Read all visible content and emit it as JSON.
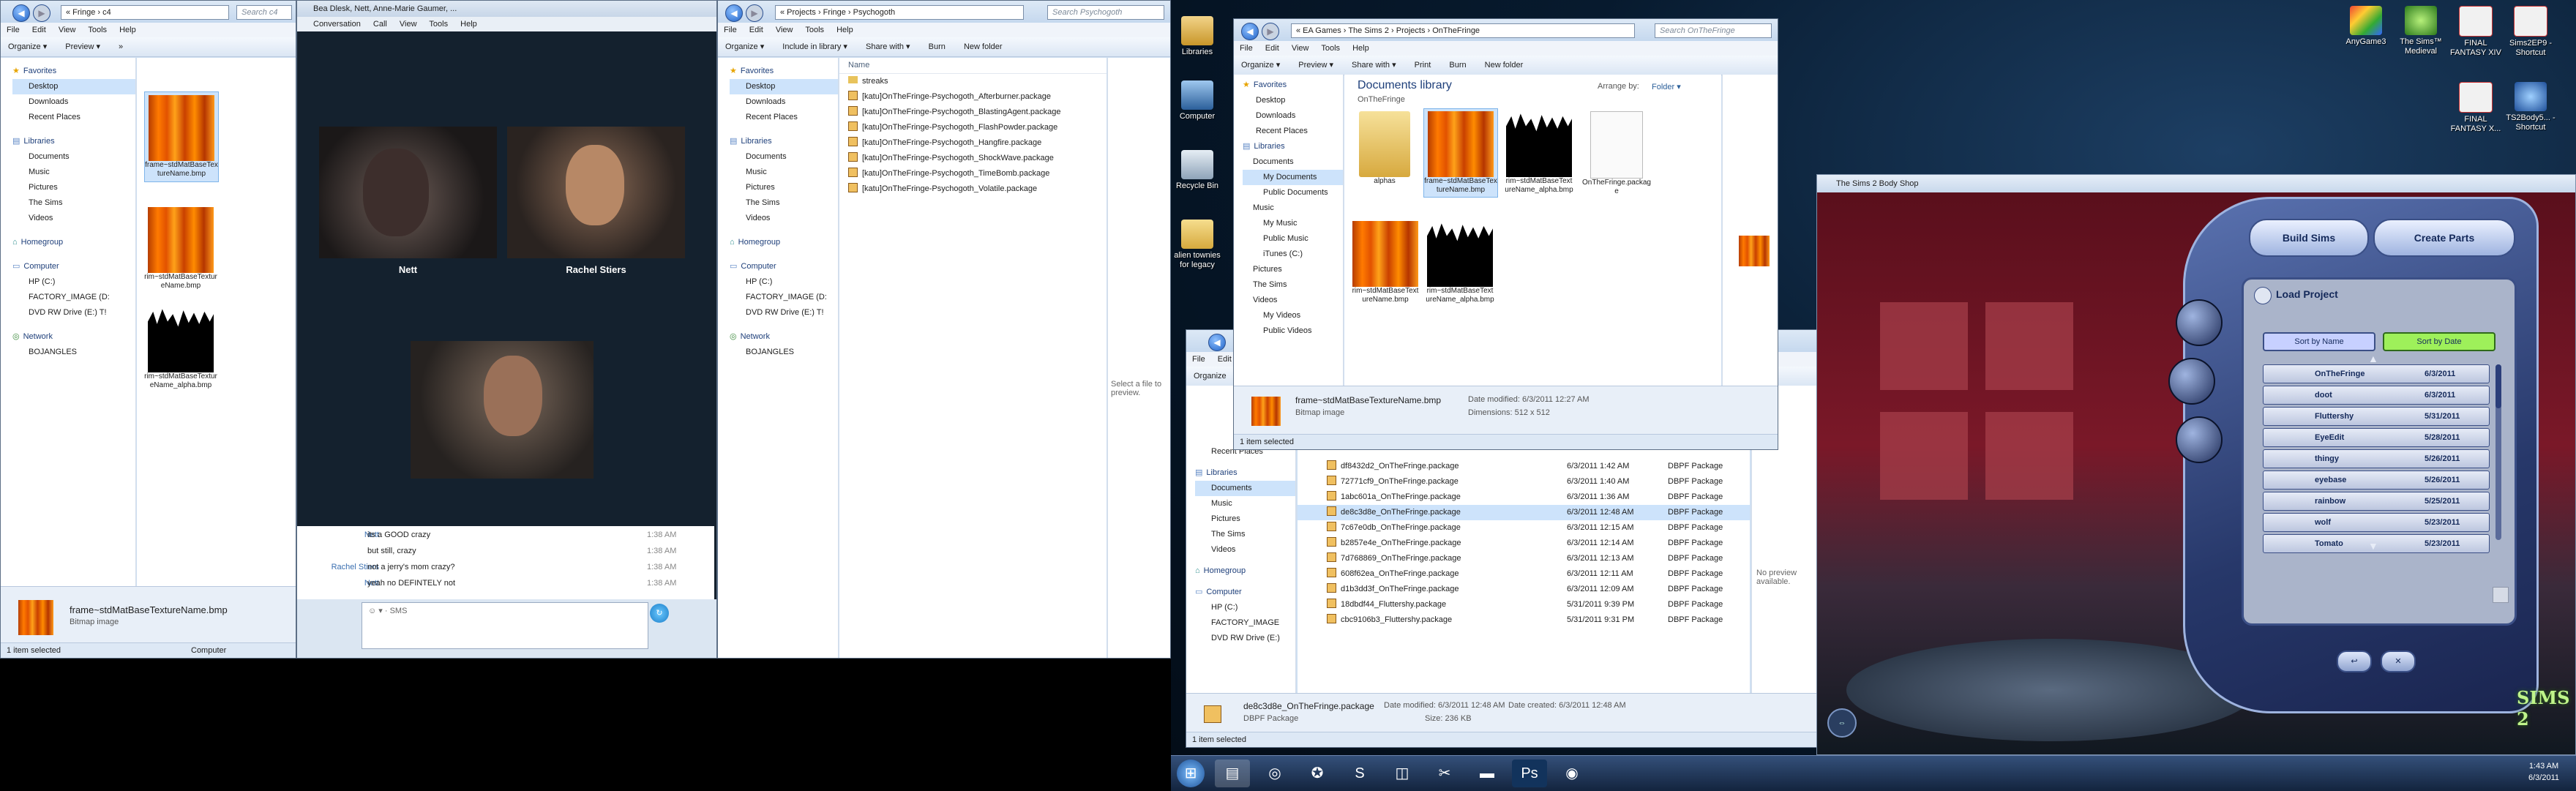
{
  "explorer1": {
    "address": "« Fringe › c4",
    "search": "Search c4",
    "menu": [
      "File",
      "Edit",
      "View",
      "Tools",
      "Help"
    ],
    "cmd": [
      "Organize ▾",
      "Preview ▾",
      "»"
    ],
    "nav": {
      "favorites": "Favorites",
      "desktop": "Desktop",
      "downloads": "Downloads",
      "recent": "Recent Places",
      "libraries": "Libraries",
      "documents": "Documents",
      "music": "Music",
      "pictures": "Pictures",
      "thesims": "The Sims",
      "videos": "Videos",
      "homegroup": "Homegroup",
      "computer": "Computer",
      "hp": "HP (C:)",
      "factory": "FACTORY_IMAGE (D:",
      "dvd": "DVD RW Drive (E:) T!",
      "network": "Network",
      "bojangles": "BOJANGLES"
    },
    "files": [
      "frame~stdMatBaseTextureName.bmp",
      "rim~stdMatBaseTextureName.bmp",
      "rim~stdMatBaseTextureName_alpha.bmp"
    ],
    "details_name": "frame~stdMatBaseTextureName.bmp",
    "details_type": "Bitmap image",
    "status": "1 item selected",
    "status_right": "Computer"
  },
  "chat": {
    "title": "Bea Dlesk, Nett, Anne-Marie Gaumer, ...",
    "menu": [
      "Conversation",
      "Call",
      "View",
      "Tools",
      "Help"
    ],
    "cam1_name": "Nett",
    "cam2_name": "Rachel Stiers",
    "messages": [
      {
        "who": "Nett",
        "text": "its a GOOD crazy",
        "time": "1:38 AM"
      },
      {
        "who": "",
        "text": "but still, crazy",
        "time": "1:38 AM"
      },
      {
        "who": "Rachel Stiers",
        "text": "not a jerry's mom crazy?",
        "time": "1:38 AM"
      },
      {
        "who": "Nett",
        "text": "yeah no DEFINTELY not",
        "time": "1:38 AM"
      }
    ],
    "input_mode": "SMS"
  },
  "explorer2": {
    "address": "« Projects › Fringe › Psychogoth",
    "search": "Search Psychogoth",
    "menu": [
      "File",
      "Edit",
      "View",
      "Tools",
      "Help"
    ],
    "cmd": [
      "Organize ▾",
      "Include in library ▾",
      "Share with ▾",
      "Burn",
      "New folder"
    ],
    "col_name": "Name",
    "files": [
      "streaks",
      "[katu]OnTheFringe-Psychogoth_Afterburner.package",
      "[katu]OnTheFringe-Psychogoth_BlastingAgent.package",
      "[katu]OnTheFringe-Psychogoth_FlashPowder.package",
      "[katu]OnTheFringe-Psychogoth_Hangfire.package",
      "[katu]OnTheFringe-Psychogoth_ShockWave.package",
      "[katu]OnTheFringe-Psychogoth_TimeBomb.package",
      "[katu]OnTheFringe-Psychogoth_Volatile.package"
    ],
    "preview_hint": "Select a file to preview."
  },
  "explorer3": {
    "address": "« EA Games › The Sims 2 › Projects › OnTheFringe",
    "search": "Search OnTheFringe",
    "menu": [
      "File",
      "Edit",
      "View",
      "Tools",
      "Help"
    ],
    "cmd": [
      "Organize ▾",
      "Preview ▾",
      "Share with ▾",
      "Print",
      "Burn",
      "New folder"
    ],
    "lib_title": "Documents library",
    "lib_sub": "OnTheFringe",
    "arrange_label": "Arrange by:",
    "arrange_value": "Folder ▾",
    "nav": [
      "Favorites",
      "Desktop",
      "Downloads",
      "Recent Places",
      "Libraries",
      "Documents",
      "My Documents",
      "Public Documents",
      "Music",
      "My Music",
      "Public Music",
      "iTunes (C:)",
      "Pictures",
      "The Sims",
      "Videos",
      "My Videos",
      "Public Videos"
    ],
    "files": [
      "alphas",
      "frame~stdMatBaseTextureName.bmp",
      "rim~stdMatBaseTextureName_alpha.bmp",
      "OnTheFringe.package",
      "rim~stdMatBaseTextureName.bmp",
      "rim~stdMatBaseTextureName_alpha.bmp"
    ],
    "details_name": "frame~stdMatBaseTextureName.bmp",
    "details_type": "Bitmap image",
    "details_modified": "Date modified: 6/3/2011 12:27 AM",
    "details_dims": "Dimensions: 512 x 512",
    "status": "1 item selected"
  },
  "explorer4": {
    "cmd_org": "Organize",
    "nav": [
      "Recent Places",
      "Libraries",
      "Documents",
      "Music",
      "Pictures",
      "The Sims",
      "Videos",
      "Homegroup",
      "Computer",
      "HP (C:)",
      "FACTORY_IMAGE",
      "DVD RW Drive (E:)"
    ],
    "rows": [
      {
        "name": "df8432d2_OnTheFringe.package",
        "date": "6/3/2011 1:42 AM",
        "type": "DBPF Package"
      },
      {
        "name": "72771cf9_OnTheFringe.package",
        "date": "6/3/2011 1:40 AM",
        "type": "DBPF Package"
      },
      {
        "name": "1abc601a_OnTheFringe.package",
        "date": "6/3/2011 1:36 AM",
        "type": "DBPF Package"
      },
      {
        "name": "de8c3d8e_OnTheFringe.package",
        "date": "6/3/2011 12:48 AM",
        "type": "DBPF Package"
      },
      {
        "name": "7c67e0db_OnTheFringe.package",
        "date": "6/3/2011 12:15 AM",
        "type": "DBPF Package"
      },
      {
        "name": "b2857e4e_OnTheFringe.package",
        "date": "6/3/2011 12:14 AM",
        "type": "DBPF Package"
      },
      {
        "name": "7d768869_OnTheFringe.package",
        "date": "6/3/2011 12:13 AM",
        "type": "DBPF Package"
      },
      {
        "name": "608f62ea_OnTheFringe.package",
        "date": "6/3/2011 12:11 AM",
        "type": "DBPF Package"
      },
      {
        "name": "d1b3dd3f_OnTheFringe.package",
        "date": "6/3/2011 12:09 AM",
        "type": "DBPF Package"
      },
      {
        "name": "18dbdf44_Fluttershy.package",
        "date": "5/31/2011 9:39 PM",
        "type": "DBPF Package"
      },
      {
        "name": "cbc9106b3_Fluttershy.package",
        "date": "5/31/2011 9:31 PM",
        "type": "DBPF Package"
      }
    ],
    "no_preview": "No preview available.",
    "details_name": "de8c3d8e_OnTheFringe.package",
    "details_type": "DBPF Package",
    "details_modified": "Date modified: 6/3/2011 12:48 AM",
    "details_size": "Size: 236 KB",
    "details_created": "Date created: 6/3/2011 12:48 AM",
    "status": "1 item selected"
  },
  "desktop_left": [
    {
      "label": "Libraries"
    },
    {
      "label": "Computer"
    },
    {
      "label": "Recycle Bin"
    },
    {
      "label": "alien townies for legacy"
    }
  ],
  "desktop_right": [
    {
      "label": "AnyGame3"
    },
    {
      "label": "The Sims™ Medieval"
    },
    {
      "label": "FINAL FANTASY XIV"
    },
    {
      "label": "Sims2EP9 - Shortcut"
    },
    {
      "label": "FINAL FANTASY X..."
    },
    {
      "label": "TS2Body5... - Shortcut"
    }
  ],
  "sims": {
    "title": "The Sims 2 Body Shop",
    "build_sims": "Build Sims",
    "create_parts": "Create Parts",
    "load_project": "Load Project",
    "sort_name": "Sort by Name",
    "sort_date": "Sort by Date",
    "projects": [
      {
        "name": "OnTheFringe",
        "date": "6/3/2011"
      },
      {
        "name": "doot",
        "date": "6/3/2011"
      },
      {
        "name": "Fluttershy",
        "date": "5/31/2011"
      },
      {
        "name": "EyeEdit",
        "date": "5/28/2011"
      },
      {
        "name": "thingy",
        "date": "5/26/2011"
      },
      {
        "name": "eyebase",
        "date": "5/26/2011"
      },
      {
        "name": "rainbow",
        "date": "5/25/2011"
      },
      {
        "name": "wolf",
        "date": "5/23/2011"
      },
      {
        "name": "Tomato",
        "date": "5/23/2011"
      }
    ],
    "logo": "SIMS 2"
  },
  "taskbar": {
    "time": "1:43 AM",
    "date": "6/3/2011"
  },
  "colors": {
    "taskbar": "#1d2f4a",
    "explorer_chrome": "#cfdff1",
    "sims_panel": "#3b4f86",
    "sims_bg": "#6a1020",
    "sort_active": "#9ef05a"
  }
}
